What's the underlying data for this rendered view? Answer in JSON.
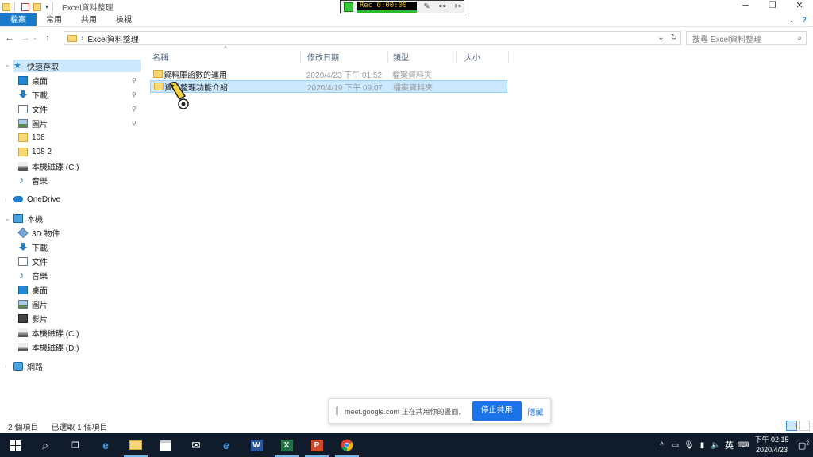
{
  "window": {
    "title": "Excel資料整理",
    "controls": [
      "─",
      "❐",
      "✕"
    ]
  },
  "recorder": {
    "time": "Rec 0:00:00"
  },
  "ribbon": {
    "tabs": [
      "檔案",
      "常用",
      "共用",
      "檢視"
    ]
  },
  "address": {
    "path": "Excel資料整理",
    "search_placeholder": "搜尋 Excel資料整理"
  },
  "nav": {
    "quick_access": "快速存取",
    "quick_items": [
      "桌面",
      "下載",
      "文件",
      "圖片",
      "108",
      "108 2",
      "本機磁碟 (C:)",
      "音樂"
    ],
    "onedrive": "OneDrive",
    "this_pc": "本機",
    "pc_items": [
      "3D 物件",
      "下載",
      "文件",
      "音樂",
      "桌面",
      "圖片",
      "影片",
      "本機磁碟 (C:)",
      "本機磁碟 (D:)"
    ],
    "network": "網路"
  },
  "list": {
    "columns": [
      "名稱",
      "修改日期",
      "類型",
      "大小"
    ],
    "rows": [
      {
        "name": "資料庫函數的運用",
        "date": "2020/4/23 下午 01:52",
        "type": "檔案資料夾"
      },
      {
        "name": "資料整理功能介紹",
        "date": "2020/4/19 下午 09:07",
        "type": "檔案資料夾"
      }
    ]
  },
  "status": {
    "count": "2 個項目",
    "selected": "已選取 1 個項目"
  },
  "meet": {
    "text": "meet.google.com 正在共用你的畫面。",
    "stop": "停止共用",
    "hide": "隱藏"
  },
  "taskbar": {
    "ime": "英",
    "time": "下午 02:15",
    "date": "2020/4/23",
    "notifications": "2"
  }
}
